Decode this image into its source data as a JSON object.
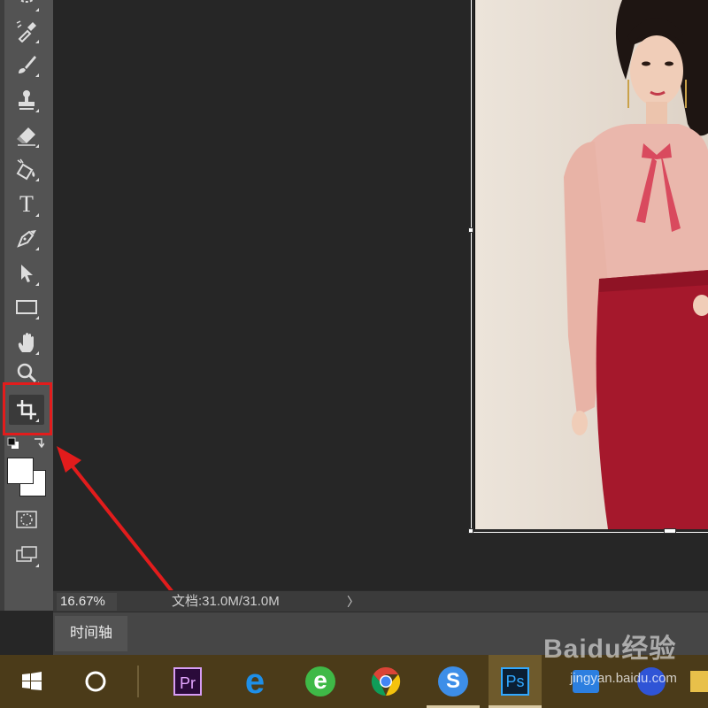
{
  "toolbar": {
    "tools": [
      {
        "name": "lasso-tool"
      },
      {
        "name": "eyedropper-tool"
      },
      {
        "name": "brush-tool"
      },
      {
        "name": "stamp-tool"
      },
      {
        "name": "eraser-tool"
      },
      {
        "name": "paint-bucket-tool"
      },
      {
        "name": "type-tool",
        "glyph": "T"
      },
      {
        "name": "pen-tool"
      },
      {
        "name": "selection-arrow-tool"
      },
      {
        "name": "rectangle-tool"
      },
      {
        "name": "hand-tool"
      },
      {
        "name": "zoom-tool"
      },
      {
        "name": "crop-tool",
        "selected": true
      },
      {
        "name": "quick-mask-tool"
      },
      {
        "name": "screen-mode-tool"
      }
    ],
    "foreground_color": "#ffffff",
    "background_color": "#ffffff",
    "highlight_color": "#e21c1c"
  },
  "status": {
    "zoom": "16.67%",
    "doc_info": "文档:31.0M/31.0M",
    "arrow": "〉"
  },
  "timeline": {
    "tab_label": "时间轴"
  },
  "taskbar": {
    "items": [
      {
        "name": "start",
        "icon": "windows-logo"
      },
      {
        "name": "cortana",
        "icon": "circle"
      },
      {
        "name": "premiere",
        "label": "Pr"
      },
      {
        "name": "edge",
        "label": "e"
      },
      {
        "name": "ie-browser",
        "label": "e"
      },
      {
        "name": "chrome",
        "icon": "chrome"
      },
      {
        "name": "sogou",
        "label": "S"
      },
      {
        "name": "photoshop",
        "label": "Ps",
        "active": true
      }
    ]
  },
  "watermark": {
    "logo": "Baidu经验",
    "url": "jingyan.baidu.com"
  }
}
